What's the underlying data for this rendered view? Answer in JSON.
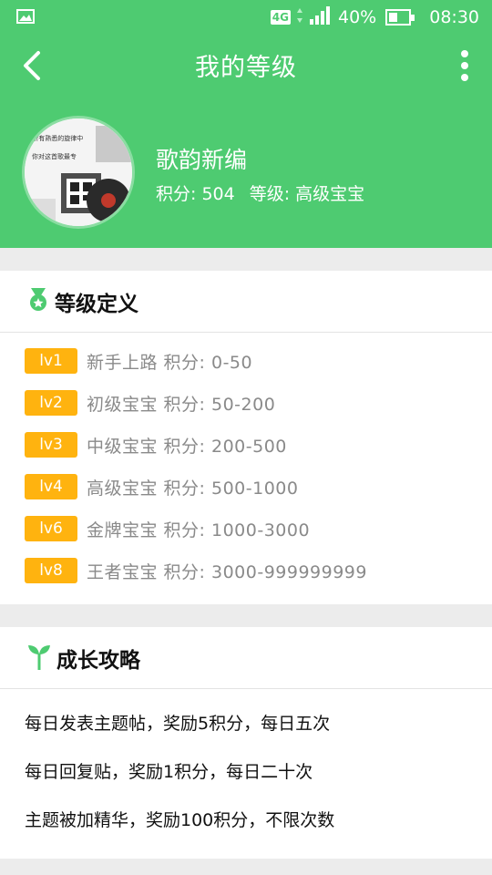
{
  "status_bar": {
    "network": "4G",
    "battery": "40%",
    "time": "08:30"
  },
  "header": {
    "title": "我的等级",
    "user": {
      "name": "歌韵新编",
      "points": "积分: 504",
      "level": "等级: 高级宝宝",
      "avatar_text": [
        "e所有熟悉的旋律中",
        "你对这首歌最专"
      ]
    }
  },
  "levels_card": {
    "title": "等级定义",
    "items": [
      {
        "badge": "lv1",
        "text": "新手上路  积分:  0-50"
      },
      {
        "badge": "lv2",
        "text": "初级宝宝  积分:  50-200"
      },
      {
        "badge": "lv3",
        "text": "中级宝宝  积分:  200-500"
      },
      {
        "badge": "lv4",
        "text": "高级宝宝  积分:  500-1000"
      },
      {
        "badge": "lv6",
        "text": "金牌宝宝  积分:  1000-3000"
      },
      {
        "badge": "lv8",
        "text": "王者宝宝  积分:  3000-999999999"
      }
    ]
  },
  "growth_card": {
    "title": "成长攻略",
    "items": [
      "每日发表主题帖，奖励5积分，每日五次",
      "每日回复贴，奖励1积分，每日二十次",
      "主题被加精华，奖励100积分，不限次数"
    ]
  },
  "colors": {
    "primary": "#4ecb71",
    "badge": "#ffb30f",
    "background": "#ececec"
  },
  "icons": {
    "gallery": "gallery-icon",
    "back": "back-arrow-icon",
    "more": "more-vert-icon",
    "medal": "medal-icon",
    "sprout": "sprout-icon"
  }
}
